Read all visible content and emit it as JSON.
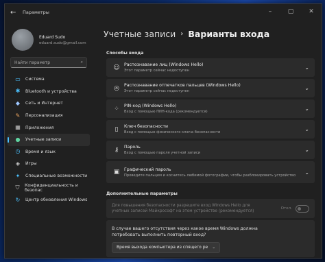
{
  "window": {
    "title": "Параметры",
    "controls": [
      "–",
      "▢",
      "✕"
    ]
  },
  "account": {
    "name": "Eduard Sudo",
    "email": "eduard.sudo@gmail.com"
  },
  "search": {
    "placeholder": "Найти параметр"
  },
  "sidebar": {
    "items": [
      {
        "label": "Система",
        "icon": "monitor-icon",
        "color": "#4cc2ff"
      },
      {
        "label": "Bluetooth и устройства",
        "icon": "bluetooth-icon",
        "color": "#4cc2ff"
      },
      {
        "label": "Сеть и Интернет",
        "icon": "network-icon",
        "color": "#9ec7ff"
      },
      {
        "label": "Персонализация",
        "icon": "brush-icon",
        "color": "#f0a860"
      },
      {
        "label": "Приложения",
        "icon": "apps-icon",
        "color": "#c7c7c7"
      },
      {
        "label": "Учетные записи",
        "icon": "person-icon",
        "color": "#5fd3a0",
        "active": true
      },
      {
        "label": "Время и язык",
        "icon": "globe-clock-icon",
        "color": "#4cc2ff"
      },
      {
        "label": "Игры",
        "icon": "gamepad-icon",
        "color": "#c7c7c7"
      },
      {
        "label": "Специальные возможности",
        "icon": "accessibility-icon",
        "color": "#4cc2ff"
      },
      {
        "label": "Конфиденциальность и безопас",
        "icon": "shield-icon",
        "color": "#c7c7c7"
      },
      {
        "label": "Центр обновления Windows",
        "icon": "update-icon",
        "color": "#4cc2ff"
      }
    ]
  },
  "breadcrumb": {
    "parent": "Учетные записи",
    "separator": "›",
    "current": "Варианты входа"
  },
  "signin": {
    "heading": "Способы входа",
    "options": [
      {
        "title": "Распознавание лиц (Windows Hello)",
        "subtitle": "Этот параметр сейчас недоступен",
        "icon": "face-icon"
      },
      {
        "title": "Распознавание отпечатков пальцев (Windows Hello)",
        "subtitle": "Этот параметр сейчас недоступен",
        "icon": "fingerprint-icon"
      },
      {
        "title": "PIN-код (Windows Hello)",
        "subtitle": "Вход с помощью ПИН-кода (рекомендуется)",
        "icon": "pin-icon"
      },
      {
        "title": "Ключ безопасности",
        "subtitle": "Вход с помощью физического ключа безопасности",
        "icon": "security-key-icon"
      },
      {
        "title": "Пароль",
        "subtitle": "Вход с помощью пароля учетной записи",
        "icon": "key-icon"
      },
      {
        "title": "Графический пароль",
        "subtitle": "Проведите пальцем и коснитесь любимой фотографии, чтобы разблокировать устройство",
        "icon": "picture-password-icon"
      }
    ]
  },
  "additional": {
    "heading": "Дополнительные параметры",
    "hello_only_text": "Для повышения безопасности разрешите вход Windows Hello для учетных записей Майкрософт на этом устройстве (рекомендуется)",
    "toggle_label": "Откл.",
    "toggle_on": false,
    "away_question": "В случае вашего отсутствия через какое время Windows должна потребовать выполнить повторный вход?",
    "away_select_value": "Время выхода компьютера из спящего ре"
  }
}
